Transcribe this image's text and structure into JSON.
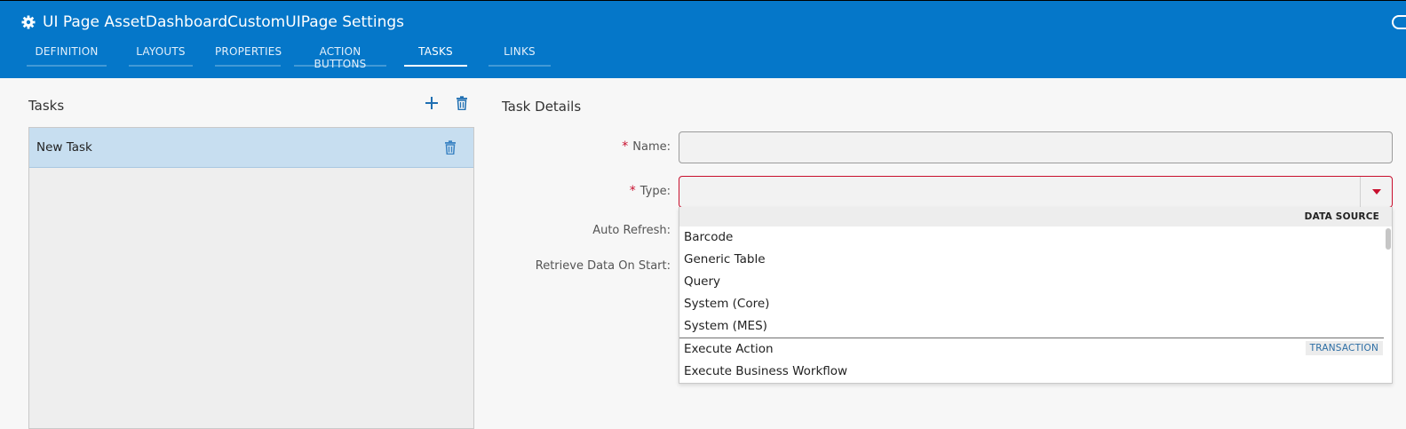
{
  "window": {
    "title": "UI Page AssetDashboardCustomUIPage Settings",
    "icon": "gear-icon"
  },
  "tabs": [
    {
      "label": "DEFINITION",
      "active": false
    },
    {
      "label": "LAYOUTS",
      "active": false
    },
    {
      "label": "PROPERTIES",
      "active": false
    },
    {
      "label": "ACTION BUTTONS",
      "active": false
    },
    {
      "label": "TASKS",
      "active": true
    },
    {
      "label": "LINKS",
      "active": false
    }
  ],
  "tasks_panel": {
    "title": "Tasks",
    "add_icon": "plus-icon",
    "delete_icon": "trash-icon",
    "items": [
      {
        "label": "New Task",
        "selected": true
      }
    ]
  },
  "details": {
    "title": "Task Details",
    "required_marker": "*",
    "fields": {
      "name": {
        "label": "Name:",
        "value": ""
      },
      "type": {
        "label": "Type:",
        "value": ""
      },
      "auto_refresh": {
        "label": "Auto Refresh:"
      },
      "retrieve_data": {
        "label": "Retrieve Data On Start:"
      }
    }
  },
  "type_dropdown": {
    "groups": [
      {
        "name": "DATA SOURCE",
        "options": [
          "Barcode",
          "Generic Table",
          "Query",
          "System (Core)",
          "System (MES)"
        ]
      },
      {
        "name": "TRANSACTION",
        "options": [
          "Execute Action",
          "Execute Business Workflow"
        ]
      }
    ]
  },
  "colors": {
    "header_bg": "#0577c9",
    "selected_row": "#c7def0",
    "required": "#c8102e",
    "icon_blue": "#1f6fb2"
  }
}
